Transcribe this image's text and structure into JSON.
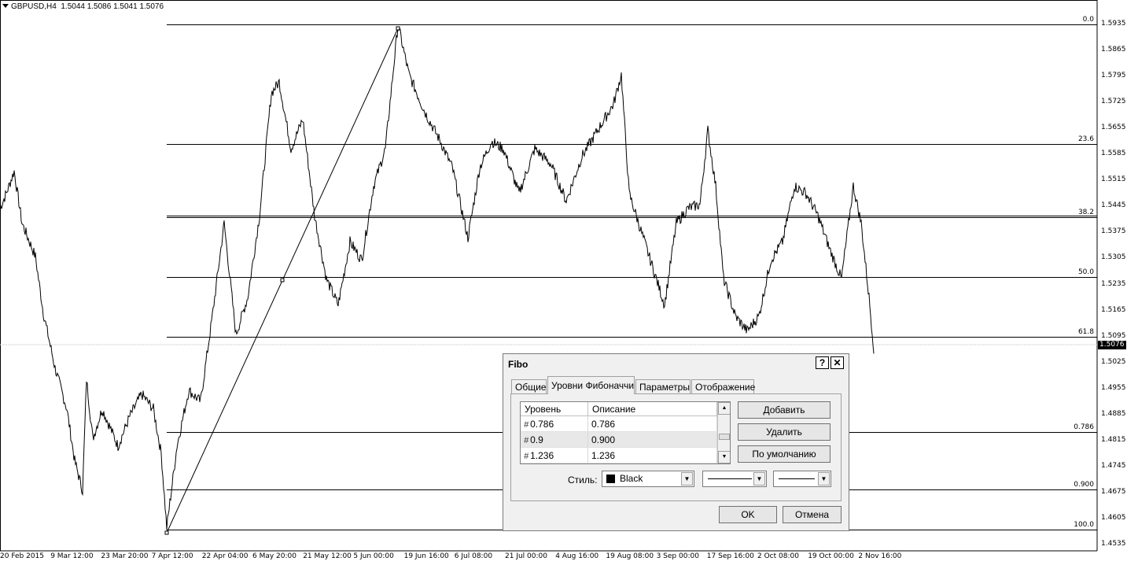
{
  "chart": {
    "symbol_info": "GBPUSD,H4  1.5044 1.5086 1.5041 1.5076",
    "current_price": "1.5076",
    "price_axis": [
      {
        "label": "1.5935",
        "price": 1.5935
      },
      {
        "label": "1.5865",
        "price": 1.5865
      },
      {
        "label": "1.5795",
        "price": 1.5795
      },
      {
        "label": "1.5725",
        "price": 1.5725
      },
      {
        "label": "1.5655",
        "price": 1.5655
      },
      {
        "label": "1.5585",
        "price": 1.5585
      },
      {
        "label": "1.5515",
        "price": 1.5515
      },
      {
        "label": "1.5445",
        "price": 1.5445
      },
      {
        "label": "1.5375",
        "price": 1.5375
      },
      {
        "label": "1.5305",
        "price": 1.5305
      },
      {
        "label": "1.5235",
        "price": 1.5235
      },
      {
        "label": "1.5165",
        "price": 1.5165
      },
      {
        "label": "1.5095",
        "price": 1.5095
      },
      {
        "label": "1.5025",
        "price": 1.5025
      },
      {
        "label": "1.4955",
        "price": 1.4955
      },
      {
        "label": "1.4885",
        "price": 1.4885
      },
      {
        "label": "1.4815",
        "price": 1.4815
      },
      {
        "label": "1.4745",
        "price": 1.4745
      },
      {
        "label": "1.4675",
        "price": 1.4675
      },
      {
        "label": "1.4605",
        "price": 1.4605
      },
      {
        "label": "1.4535",
        "price": 1.4535
      }
    ],
    "time_axis": [
      "20 Feb 2015",
      "9 Mar 12:00",
      "23 Mar 20:00",
      "7 Apr 12:00",
      "22 Apr 04:00",
      "6 May 20:00",
      "21 May 12:00",
      "5 Jun 00:00",
      "19 Jun 16:00",
      "6 Jul 08:00",
      "21 Jul 00:00",
      "4 Aug 16:00",
      "19 Aug 08:00",
      "3 Sep 00:00",
      "17 Sep 16:00",
      "2 Oct 08:00",
      "19 Oct 00:00",
      "2 Nov 16:00"
    ],
    "fib_levels": [
      {
        "label": "0.0",
        "price": 1.5935
      },
      {
        "label": "23.6",
        "price": 1.5614
      },
      {
        "label": "38.2",
        "price": 1.5416
      },
      {
        "label": "50.0",
        "price": 1.5255
      },
      {
        "label": "61.8",
        "price": 1.5094
      },
      {
        "label": "0.786",
        "price": 1.4838
      },
      {
        "label": "0.900",
        "price": 1.4683
      },
      {
        "label": "100.0",
        "price": 1.4575
      }
    ]
  },
  "dialog": {
    "title": "Fibo",
    "help_button": "?",
    "close_button": "✕",
    "tabs": [
      "Общие",
      "Уровни Фибоначчи",
      "Параметры",
      "Отображение"
    ],
    "active_tab": "Уровни Фибоначчи",
    "grid": {
      "headers": [
        "Уровень",
        "Описание"
      ],
      "rows": [
        {
          "level": "0.786",
          "description": "0.786"
        },
        {
          "level": "0.9",
          "description": "0.900"
        },
        {
          "level": "1.236",
          "description": "1.236"
        }
      ]
    },
    "buttons": {
      "add": "Добавить",
      "delete": "Удалить",
      "default": "По умолчанию",
      "ok": "OK",
      "cancel": "Отмена"
    },
    "style_label": "Стиль:",
    "style_color_name": "Black",
    "style_color": "#000000"
  }
}
